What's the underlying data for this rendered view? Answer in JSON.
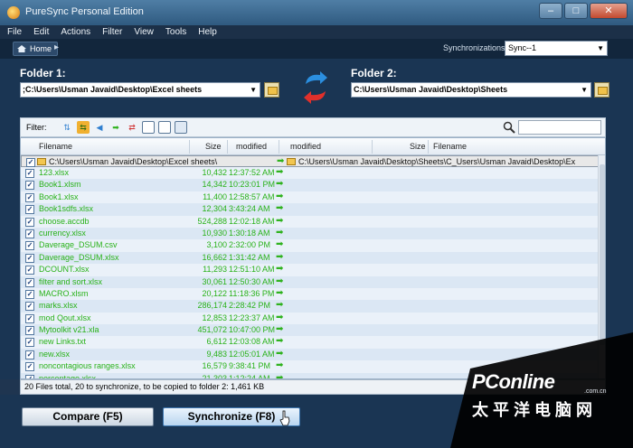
{
  "window": {
    "title": "PureSync Personal Edition",
    "min": "–",
    "max": "□",
    "close": "✕"
  },
  "menu": [
    "File",
    "Edit",
    "Actions",
    "Filter",
    "View",
    "Tools",
    "Help"
  ],
  "toolbar": {
    "home_label": "Home",
    "next_symbol": "▸",
    "sync_label": "Synchronizations:",
    "sync_value": "Sync--1"
  },
  "folder1": {
    "label": "Folder 1:",
    "path": ";C:\\Users\\Usman Javaid\\Desktop\\Excel sheets"
  },
  "folder2": {
    "label": "Folder 2:",
    "path": "C:\\Users\\Usman Javaid\\Desktop\\Sheets"
  },
  "filter": {
    "label": "Filter:"
  },
  "columns": {
    "filename": "Filename",
    "size": "Size",
    "modified": "modified",
    "modified2": "modified",
    "size2": "Size",
    "filename2": "Filename"
  },
  "root_row": {
    "left": "C:\\Users\\Usman Javaid\\Desktop\\Excel sheets\\",
    "right": "C:\\Users\\Usman Javaid\\Desktop\\Sheets\\C_Users\\Usman Javaid\\Desktop\\Ex"
  },
  "files": [
    {
      "name": "123.xlsx",
      "size": "10,432",
      "modified": "12:37:52 AM"
    },
    {
      "name": "Book1.xlsm",
      "size": "14,342",
      "modified": "10:23:01 PM"
    },
    {
      "name": "Book1.xlsx",
      "size": "11,400",
      "modified": "12:58:57 AM"
    },
    {
      "name": "Book1sdfs.xlsx",
      "size": "12,304",
      "modified": "3:43:24 AM"
    },
    {
      "name": "choose.accdb",
      "size": "524,288",
      "modified": "12:02:18 AM"
    },
    {
      "name": "currency.xlsx",
      "size": "10,930",
      "modified": "1:30:18 AM"
    },
    {
      "name": "Daverage_DSUM.csv",
      "size": "3,100",
      "modified": "2:32:00 PM"
    },
    {
      "name": "Daverage_DSUM.xlsx",
      "size": "16,662",
      "modified": "1:31:42 AM"
    },
    {
      "name": "DCOUNT.xlsx",
      "size": "11,293",
      "modified": "12:51:10 AM"
    },
    {
      "name": "filter and sort.xlsx",
      "size": "30,061",
      "modified": "12:50:30 AM"
    },
    {
      "name": "MACRO.xlsm",
      "size": "20,122",
      "modified": "11:18:36 PM"
    },
    {
      "name": "marks.xlsx",
      "size": "286,174",
      "modified": "2:28:42 PM"
    },
    {
      "name": "mod Qout.xlsx",
      "size": "12,853",
      "modified": "12:23:37 AM"
    },
    {
      "name": "Mytoolkit v21.xla",
      "size": "451,072",
      "modified": "10:47:00 PM"
    },
    {
      "name": "new Links.txt",
      "size": "6,612",
      "modified": "12:03:08 AM"
    },
    {
      "name": "new.xlsx",
      "size": "9,483",
      "modified": "12:05:01 AM"
    },
    {
      "name": "noncontagious ranges.xlsx",
      "size": "16,579",
      "modified": "9:38:41 PM"
    },
    {
      "name": "percentage.xlsx",
      "size": "21,303",
      "modified": "1:12:24 AM"
    }
  ],
  "action_symbol": "➡",
  "check_symbol": "✓",
  "status": "20 Files total,  20 to synchronize,  to be copied to folder 2: 1,461 KB",
  "buttons": {
    "compare": "Compare (F5)",
    "synchronize": "Synchronize (F8)"
  },
  "watermark": {
    "brand": "PConline",
    "domain": ".com.cn",
    "cn": "太平洋电脑网"
  },
  "colors": {
    "accent": "#1a3553",
    "sync_green": "#29b219"
  }
}
